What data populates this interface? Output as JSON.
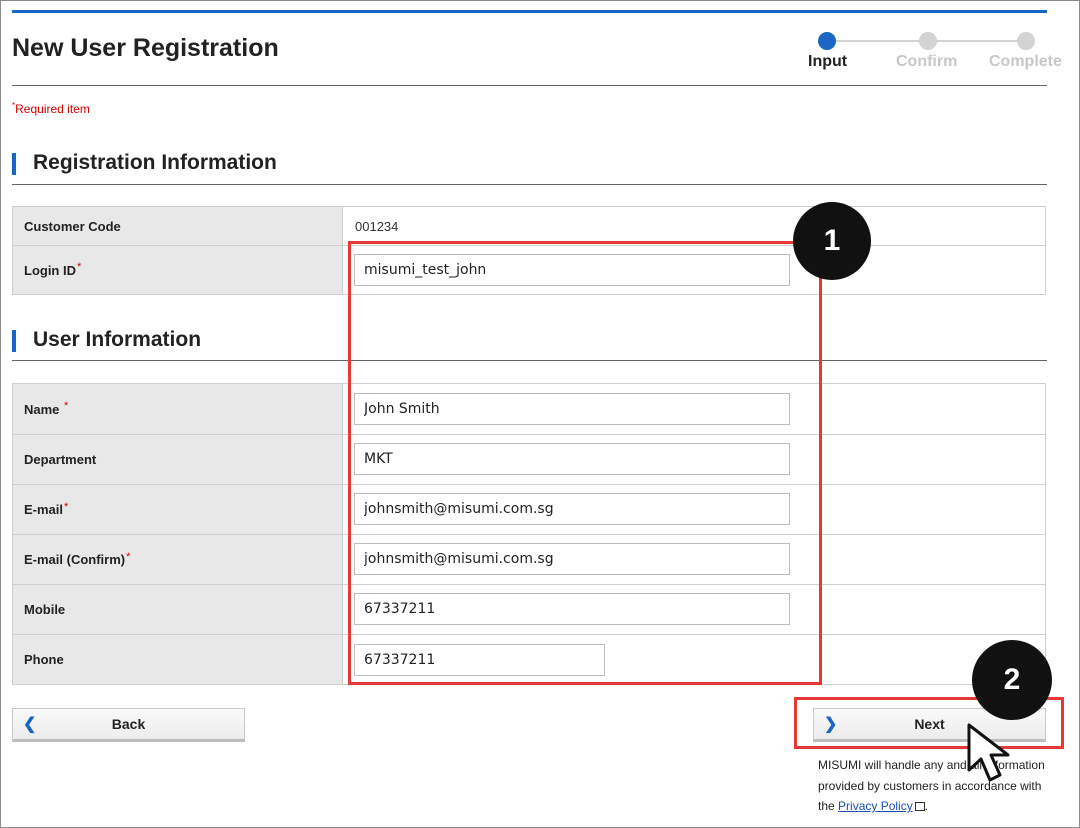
{
  "header": {
    "title": "New User Registration",
    "steps": [
      "Input",
      "Confirm",
      "Complete"
    ]
  },
  "required_note": "Required item",
  "required_mark": "*",
  "registration_section": {
    "title": "Registration Information",
    "customer_code_label": "Customer Code",
    "customer_code_value": "001234",
    "login_id_label": "Login ID",
    "login_id_value": "misumi_test_john"
  },
  "user_section": {
    "title": "User Information",
    "fields": [
      {
        "label": "Name",
        "value": "John Smith",
        "required": true
      },
      {
        "label": "Department",
        "value": "MKT",
        "required": false
      },
      {
        "label": "E-mail",
        "value": "johnsmith@misumi.com.sg",
        "required": true
      },
      {
        "label": "E-mail (Confirm)",
        "value": "johnsmith@misumi.com.sg",
        "required": true
      },
      {
        "label": "Mobile",
        "value": "67337211",
        "required": false
      },
      {
        "label": "Phone",
        "value": "67337211",
        "required": false
      }
    ]
  },
  "buttons": {
    "back": "Back",
    "next": "Next",
    "back_icon": "chevron-left-icon",
    "next_icon": "chevron-right-icon"
  },
  "privacy_note": {
    "text": "MISUMI will handle any and all information provided by customers in accordance with the",
    "link": "Privacy Policy",
    "end": "."
  },
  "annotations": {
    "badge1": "1",
    "badge2": "2",
    "color": "#e53935"
  },
  "colors": {
    "accent": "#1a66c4",
    "required": "#d40000"
  }
}
